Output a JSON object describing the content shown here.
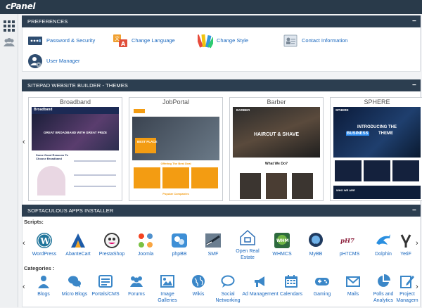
{
  "brand": {
    "logo_text": "cPanel"
  },
  "preferences": {
    "title": "PREFERENCES",
    "collapse": "−",
    "items": [
      {
        "label": "Password & Security",
        "icon": "password-dots-icon"
      },
      {
        "label": "Change Language",
        "icon": "language-translate-icon"
      },
      {
        "label": "Change Style",
        "icon": "color-swatches-icon"
      },
      {
        "label": "Contact Information",
        "icon": "contact-card-icon"
      },
      {
        "label": "User Manager",
        "icon": "user-gear-icon"
      }
    ]
  },
  "sitepad": {
    "title": "SITEPAD WEBSITE BUILDER - THEMES",
    "collapse": "−",
    "prev": "‹",
    "next": "›",
    "themes": [
      {
        "name": "Broadband",
        "brand": "Broadband",
        "hero": "GREAT BROADBAND WITH GREAT PRIZE",
        "section": "Some Good Reasons To Choose Broadband"
      },
      {
        "name": "JobPortal",
        "hero": "BEST PLACE",
        "section": "Offering The Best Deal",
        "footer": "Popular Companies"
      },
      {
        "name": "Barber",
        "brand": "BARBER",
        "hero": "HAIRCUT & SHAVE",
        "section": "What We Do?"
      },
      {
        "name": "SPHERE",
        "brand": "SPHERE",
        "hero_1": "INTRODUCING THE",
        "hero_2": "BUSINESS",
        "hero_3": "THEME",
        "section": "WHO WE ARE"
      }
    ]
  },
  "softaculous": {
    "title": "SOFTACULOUS APPS INSTALLER",
    "collapse": "−",
    "scripts_label": "Scripts:",
    "categories_label": "Categories :",
    "prev": "‹",
    "next": "›",
    "scripts": [
      {
        "label": "WordPress",
        "icon": "wordpress-icon"
      },
      {
        "label": "AbanteCart",
        "icon": "abantecart-icon"
      },
      {
        "label": "PrestaShop",
        "icon": "prestashop-icon"
      },
      {
        "label": "Joomla",
        "icon": "joomla-icon"
      },
      {
        "label": "phpBB",
        "icon": "phpbb-icon"
      },
      {
        "label": "SMF",
        "icon": "smf-icon"
      },
      {
        "label": "Open Real Estate",
        "icon": "open-real-estate-icon"
      },
      {
        "label": "WHMCS",
        "icon": "whmcs-icon"
      },
      {
        "label": "MyBB",
        "icon": "mybb-icon"
      },
      {
        "label": "pH7CMS",
        "icon": "ph7cms-icon"
      },
      {
        "label": "Dolphin",
        "icon": "dolphin-icon"
      },
      {
        "label": "YetiF",
        "icon": "yetiforce-icon"
      }
    ],
    "categories": [
      {
        "label": "Blogs",
        "icon": "blogger-person-icon"
      },
      {
        "label": "Micro Blogs",
        "icon": "chat-bubbles-icon"
      },
      {
        "label": "Portals/CMS",
        "icon": "portal-list-icon"
      },
      {
        "label": "Forums",
        "icon": "forum-group-icon"
      },
      {
        "label": "Image Galleries",
        "icon": "image-icon"
      },
      {
        "label": "Wikis",
        "icon": "globe-icon"
      },
      {
        "label": "Social Networking",
        "icon": "social-chat-icon"
      },
      {
        "label": "Ad Management",
        "icon": "megaphone-icon"
      },
      {
        "label": "Calendars",
        "icon": "calendar-icon"
      },
      {
        "label": "Gaming",
        "icon": "gamepad-icon"
      },
      {
        "label": "Mails",
        "icon": "mail-icon"
      },
      {
        "label": "Polls and Analytics",
        "icon": "pie-chart-icon"
      },
      {
        "label": "Project Managem",
        "icon": "project-edit-icon"
      }
    ]
  },
  "colors": {
    "header": "#2c3e50",
    "topbar": "#293a4a",
    "link": "#1967be",
    "accent_blue": "#3b87c8",
    "orange": "#f39c12"
  }
}
